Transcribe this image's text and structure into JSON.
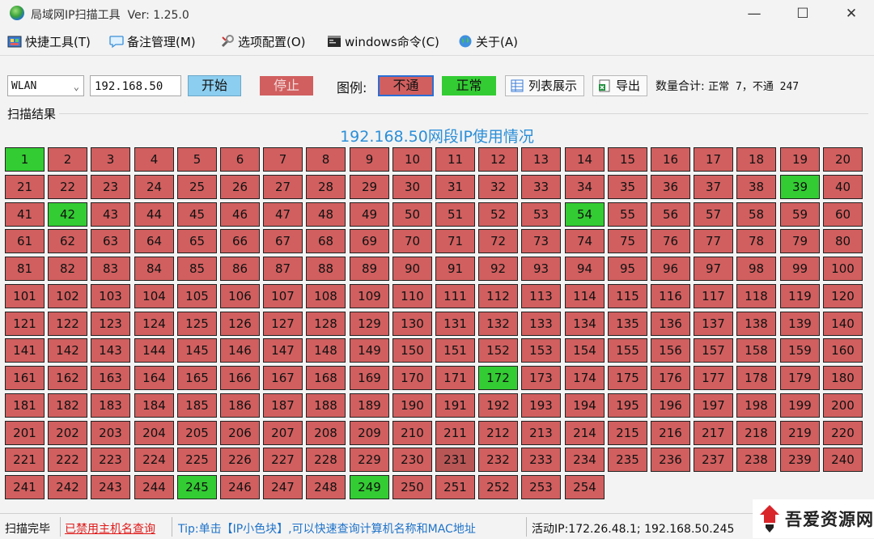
{
  "window": {
    "title": "局域网IP扫描工具",
    "version": "Ver: 1.25.0",
    "controls": {
      "minimize": "—",
      "maximize": "☐",
      "close": "✕"
    }
  },
  "menu": [
    {
      "label": "快捷工具(T)",
      "icon": "toolbox-icon"
    },
    {
      "label": "备注管理(M)",
      "icon": "speech-bubble-icon"
    },
    {
      "label": "选项配置(O)",
      "icon": "wrench-icon"
    },
    {
      "label": "windows命令(C)",
      "icon": "terminal-icon"
    },
    {
      "label": "关于(A)",
      "icon": "globe-icon"
    }
  ],
  "toolbar": {
    "interface_value": "WLAN",
    "ip_value": "192.168.50",
    "start_label": "开始",
    "stop_label": "停止",
    "legend_label": "图例:",
    "legend_fail": "不通",
    "legend_ok": "正常",
    "list_button": "列表展示",
    "export_button": "导出",
    "count_prefix": "数量合计:",
    "count_detail": "正常 7，不通 247"
  },
  "results": {
    "group_label": "扫描结果",
    "title": "192.168.50网段IP使用情况",
    "columns": 20,
    "total": 254,
    "online": [
      1,
      39,
      42,
      54,
      172,
      245,
      249
    ],
    "dim": [
      231
    ],
    "colors": {
      "offline": "#d15f5f",
      "online": "#33cc33",
      "title": "#2b8fd8"
    }
  },
  "status": {
    "state": "扫描完毕",
    "hostname_disabled": "已禁用主机名查询",
    "tip": "Tip:单击【IP小色块】,可以快速查询计算机名称和MAC地址",
    "active_ip": "活动IP:172.26.48.1; 192.168.50.245"
  },
  "watermark": {
    "text": "吾爱资源网"
  }
}
